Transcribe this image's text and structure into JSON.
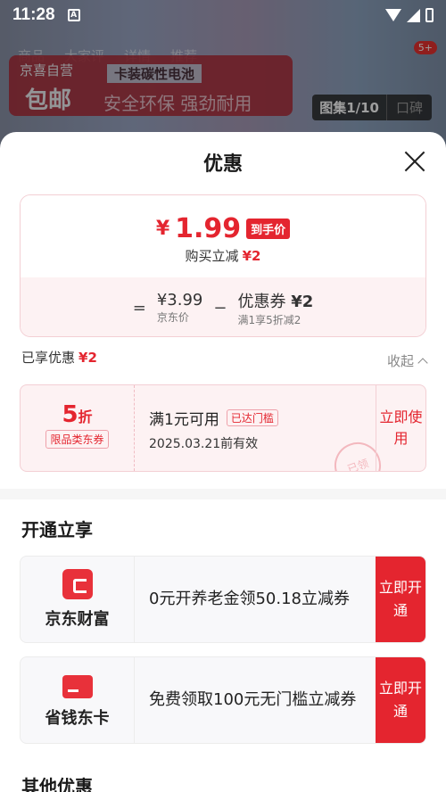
{
  "status_bar": {
    "time": "11:28",
    "a_icon": "A"
  },
  "background": {
    "nav": [
      "商品",
      "大家评",
      "详情",
      "推荐"
    ],
    "cart_badge": "5+",
    "banner_brand": "京喜自营",
    "banner_product": "卡装碳性电池",
    "banner_free": "包邮",
    "banner_slogan": "安全环保 强劲耐用",
    "gallery_label": "图集1/10",
    "reviews_label": "口碑"
  },
  "sheet": {
    "title": "优惠",
    "price": {
      "yen": "¥",
      "amount": "1.99",
      "tag": "到手价",
      "reduce_label": "购买立减",
      "reduce_amount": "¥2"
    },
    "breakdown": {
      "equals": "=",
      "jd_price": "¥3.99",
      "jd_price_label": "京东价",
      "minus": "−",
      "coupon_main": "优惠券",
      "coupon_amount": "¥2",
      "coupon_sub": "满1享5折减2"
    },
    "enjoyed_label": "已享优惠",
    "enjoyed_amount": "¥2",
    "collapse_label": "收起",
    "coupon": {
      "discount": "5",
      "discount_unit": "折",
      "category": "限品类东券",
      "condition": "满1元可用",
      "reached": "已达门槛",
      "valid": "2025.03.21前有效",
      "use_button": "立即使用",
      "stamp": "已领"
    },
    "open_section_title": "开通立享",
    "services": [
      {
        "icon": "wallet-icon",
        "name": "京东财富",
        "desc": "0元开养老金领50.18立减券",
        "button": "立即开通"
      },
      {
        "icon": "card-icon",
        "name": "省钱东卡",
        "desc": "免费领取100元无门槛立减券",
        "button": "立即开通"
      }
    ],
    "other_section_title": "其他优惠"
  },
  "colors": {
    "accent": "#e4252f",
    "coupon_bg": "#fdf2f3"
  }
}
